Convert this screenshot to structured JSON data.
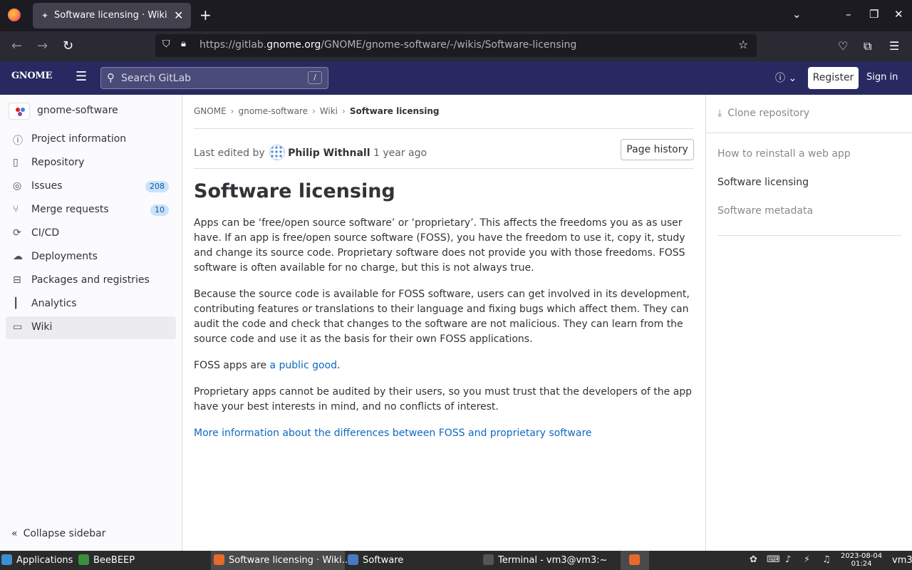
{
  "browser": {
    "tab_title": "Software licensing · Wiki · GNOME / gnome-software · GitLab",
    "url_prefix": "https://gitlab.",
    "url_domain": "gnome.org",
    "url_path": "/GNOME/gnome-software/-/wikis/Software-licensing"
  },
  "header": {
    "logo": "GNOME",
    "search_placeholder": "Search GitLab",
    "search_shortcut": "/",
    "register_label": "Register",
    "signin_label": "Sign in"
  },
  "sidebar": {
    "project_name": "gnome-software",
    "items": [
      {
        "label": "Project information",
        "icon": "info-icon"
      },
      {
        "label": "Repository",
        "icon": "doc-icon"
      },
      {
        "label": "Issues",
        "icon": "issues-icon",
        "badge": "208"
      },
      {
        "label": "Merge requests",
        "icon": "merge-icon",
        "badge": "10"
      },
      {
        "label": "CI/CD",
        "icon": "rocket-icon"
      },
      {
        "label": "Deployments",
        "icon": "cloud-icon"
      },
      {
        "label": "Packages and registries",
        "icon": "package-icon"
      },
      {
        "label": "Analytics",
        "icon": "chart-icon"
      },
      {
        "label": "Wiki",
        "icon": "book-icon",
        "active": true
      }
    ],
    "collapse_label": "Collapse sidebar"
  },
  "breadcrumb": [
    "GNOME",
    "gnome-software",
    "Wiki",
    "Software licensing"
  ],
  "page": {
    "last_edited_prefix": "Last edited by",
    "author": "Philip Withnall",
    "edited_ago": "1 year ago",
    "history_button": "Page history",
    "title": "Software licensing",
    "p1": "Apps can be ‘free/open source software’ or ‘proprietary’. This affects the freedoms you as as user have. If an app is free/open source software (FOSS), you have the freedom to use it, copy it, study and change its source code. Proprietary software does not provide you with those freedoms. FOSS software is often available for no charge, but this is not always true.",
    "p2": "Because the source code is available for FOSS software, users can get involved in its development, contributing features or translations to their language and fixing bugs which affect them. They can audit the code and check that changes to the software are not malicious. They can learn from the source code and use it as the basis for their own FOSS applications.",
    "p3_prefix": "FOSS apps are ",
    "p3_link": "a public good",
    "p3_suffix": ".",
    "p4": "Proprietary apps cannot be audited by their users, so you must trust that the developers of the app have your best interests in mind, and no conflicts of interest.",
    "more_link": "More information about the differences between FOSS and proprietary software"
  },
  "right_sidebar": {
    "clone_label": "Clone repository",
    "pages": [
      "How to reinstall a web app",
      "Software licensing",
      "Software metadata"
    ]
  },
  "taskbar": {
    "applications": "Applications",
    "beebeep": "BeeBEEP",
    "firefox_window": "Software licensing · Wiki...",
    "software_window": "Software",
    "terminal_window": "Terminal - vm3@vm3:~",
    "clock_date": "2023-08-04",
    "clock_time": "01:24",
    "user": "vm3"
  }
}
